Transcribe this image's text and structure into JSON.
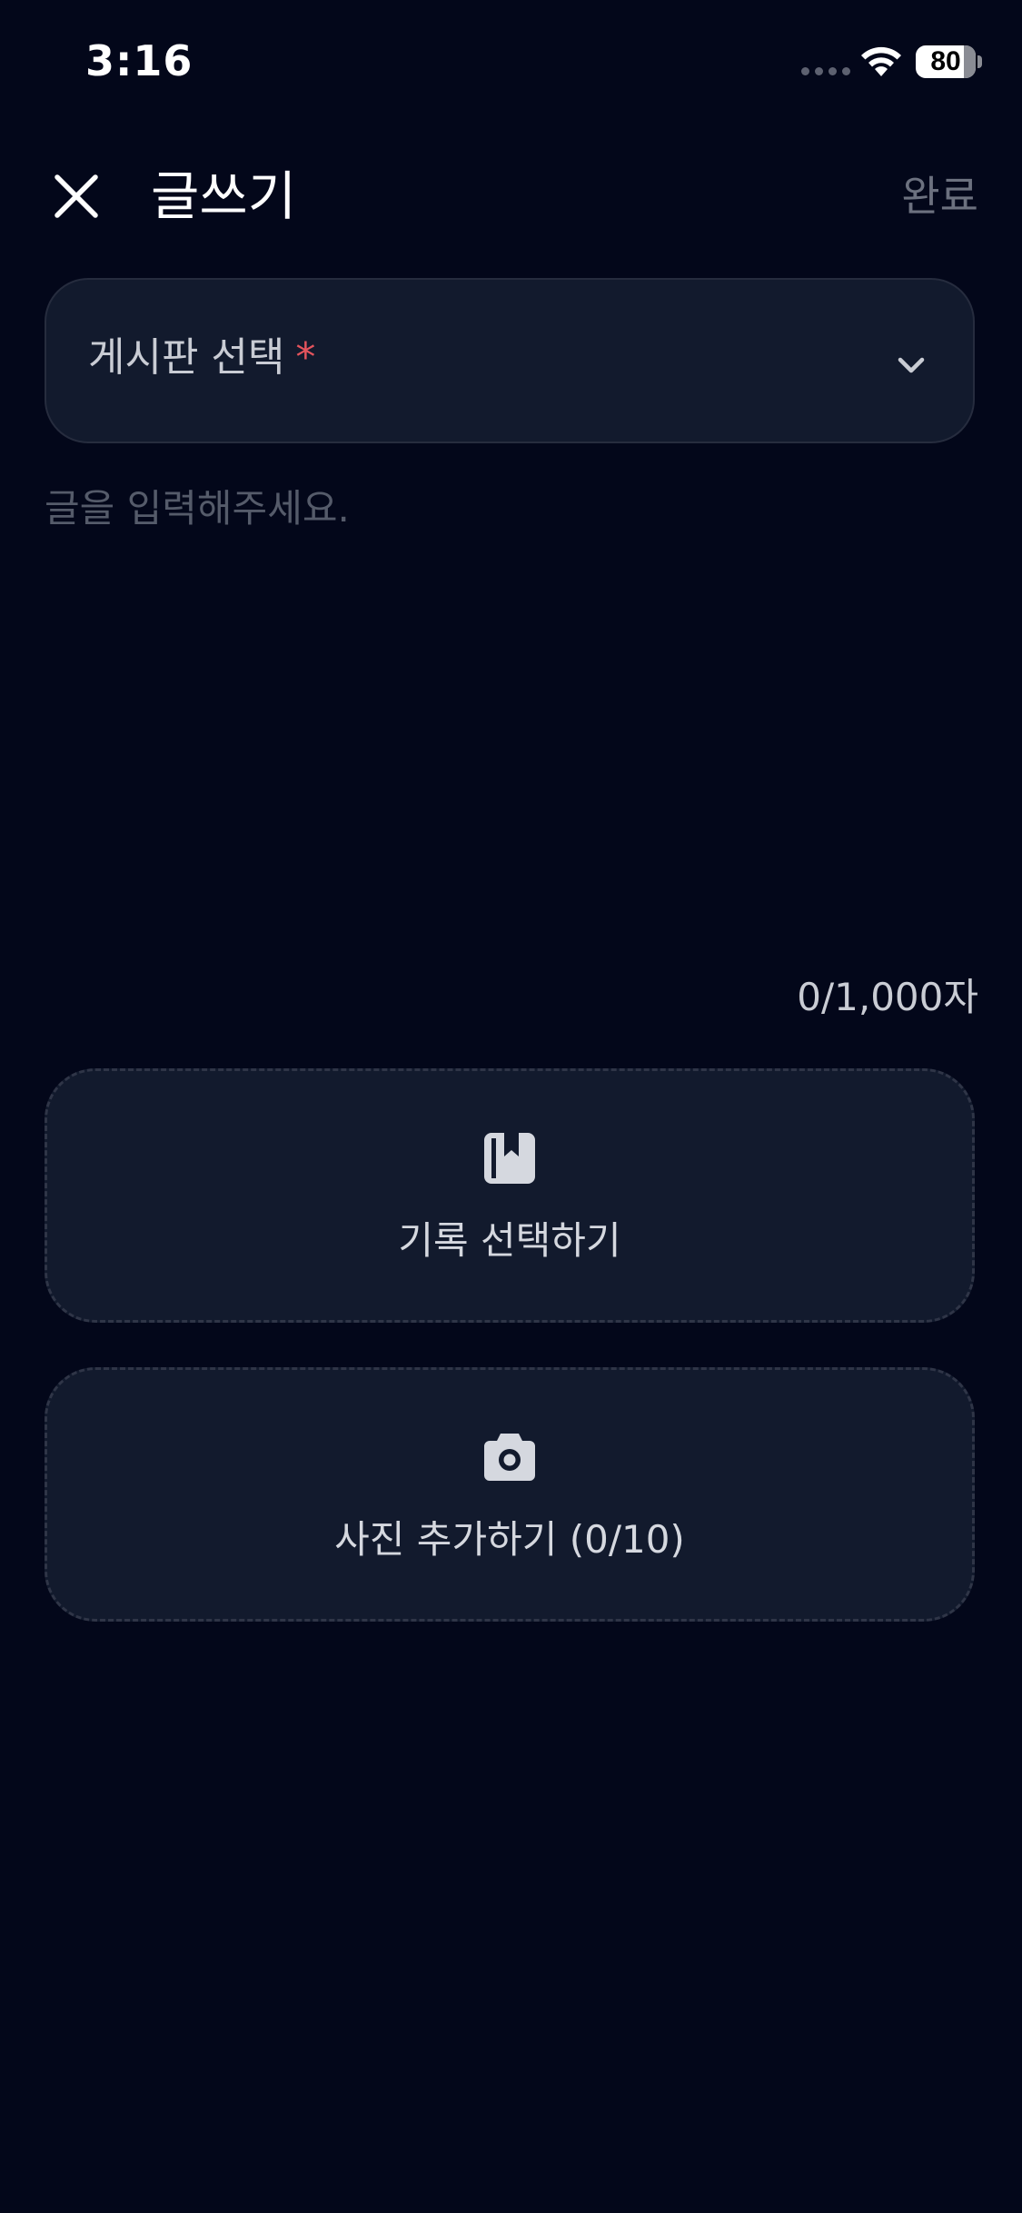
{
  "status_bar": {
    "time": "3:16",
    "battery_level": "80"
  },
  "header": {
    "title": "글쓰기",
    "done_label": "완료"
  },
  "board_select": {
    "label": "게시판 선택",
    "required_mark": "*"
  },
  "content": {
    "placeholder": "글을 입력해주세요.",
    "char_count": "0/1,000자"
  },
  "record_card": {
    "label": "기록 선택하기",
    "icon": "bookmark-book-icon"
  },
  "photo_card": {
    "label": "사진 추가하기 (0/10)",
    "icon": "camera-icon"
  },
  "colors": {
    "background": "#03071a",
    "card": "#121a2d",
    "required": "#e4545d",
    "muted": "#6c717f"
  }
}
